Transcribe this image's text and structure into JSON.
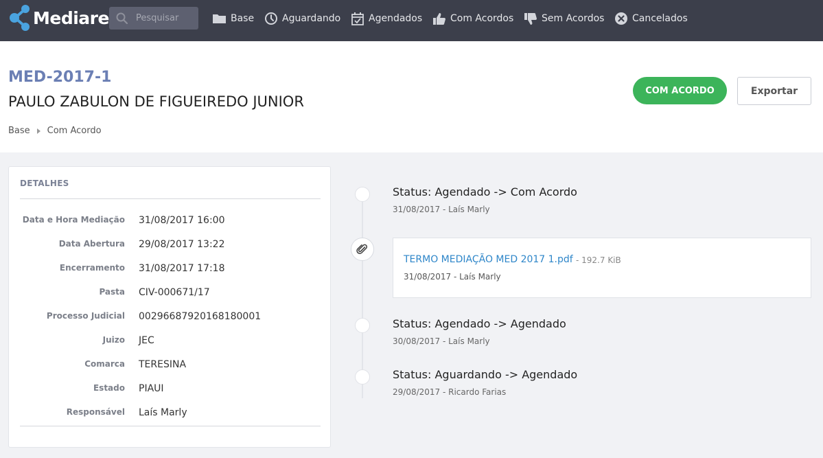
{
  "navbar": {
    "brand": "Mediare",
    "search_placeholder": "Pesquisar",
    "items": [
      {
        "label": "Base",
        "icon": "folder-icon"
      },
      {
        "label": "Aguardando",
        "icon": "clock-icon"
      },
      {
        "label": "Agendados",
        "icon": "calendar-icon"
      },
      {
        "label": "Com Acordos",
        "icon": "thumbs-up-icon"
      },
      {
        "label": "Sem Acordos",
        "icon": "thumbs-down-icon"
      },
      {
        "label": "Cancelados",
        "icon": "cancel-icon"
      }
    ]
  },
  "header": {
    "code": "MED-2017-1",
    "name": "PAULO ZABULON DE FIGUEIREDO JUNIOR",
    "breadcrumb": [
      "Base",
      "Com Acordo"
    ],
    "status_button": "COM ACORDO",
    "export_button": "Exportar"
  },
  "details": {
    "title": "DETALHES",
    "rows": [
      {
        "label": "Data e Hora Mediação",
        "value": "31/08/2017 16:00"
      },
      {
        "label": "Data Abertura",
        "value": "29/08/2017 13:22"
      },
      {
        "label": "Encerramento",
        "value": "31/08/2017 17:18"
      },
      {
        "label": "Pasta",
        "value": "CIV-000671/17"
      },
      {
        "label": "Processo Judicial",
        "value": "00296687920168180001"
      },
      {
        "label": "Juizo",
        "value": "JEC"
      },
      {
        "label": "Comarca",
        "value": "TERESINA"
      },
      {
        "label": "Estado",
        "value": "PIAUI"
      },
      {
        "label": "Responsável",
        "value": "Laís Marly"
      }
    ]
  },
  "timeline": {
    "events": [
      {
        "title": "Status: Agendado -> Com Acordo",
        "meta": "31/08/2017 - Laís Marly"
      },
      {
        "title": "Status: Agendado -> Agendado",
        "meta": "30/08/2017 - Laís Marly"
      },
      {
        "title": "Status: Aguardando -> Agendado",
        "meta": "29/08/2017 - Ricardo Farias"
      }
    ],
    "attachment": {
      "filename": "TERMO MEDIAÇÃO MED 2017 1.pdf",
      "size": "- 192.7 KiB",
      "meta": "31/08/2017 - Laís Marly"
    }
  },
  "colors": {
    "navbar": "#3c3f4b",
    "brand_accent": "#4aa3df",
    "code": "#6b7fb4",
    "success": "#3cb45a",
    "link": "#2e86c9"
  }
}
